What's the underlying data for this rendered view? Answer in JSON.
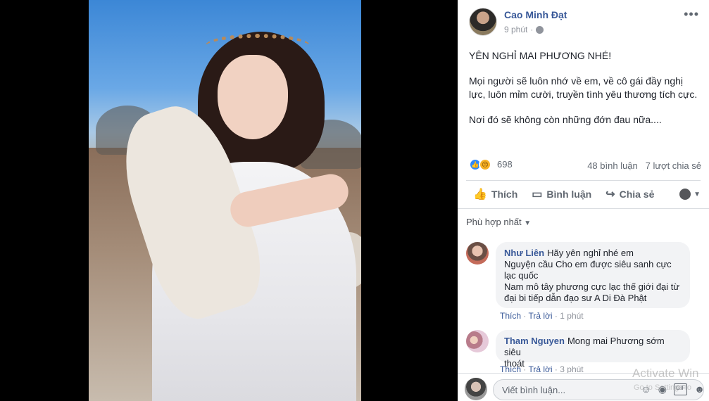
{
  "post": {
    "author": "Cao Minh Đạt",
    "time": "9 phút",
    "separator": "·",
    "more_icon": "ellipsis-icon",
    "paragraphs": [
      "YÊN NGHỈ MAI PHƯƠNG NHÉ!",
      "Mọi người sẽ luôn nhớ về em, về cô gái đầy nghị lực, luôn mỉm cười, truyền tình yêu thương tích cực.",
      "Nơi đó sẽ không còn những đớn đau nữa...."
    ],
    "reaction_count": "698",
    "comments_count": "48 bình luận",
    "shares_count": "7 lượt chia sẻ"
  },
  "actions": {
    "like": "Thích",
    "comment": "Bình luận",
    "share": "Chia sẻ"
  },
  "sort_label": "Phù hợp nhất",
  "comments": [
    {
      "name": "Như Liên",
      "first_line": "Hãy yên nghỉ nhé em",
      "lines": [
        "Nguyện cầu Cho em được siêu sanh cực",
        "lạc quốc",
        "Nam mô tây phương cực lạc thế giới đại từ",
        "đại bi tiếp dẫn đạo sư A Di Đà Phật"
      ],
      "like": "Thích",
      "reply": "Trả lời",
      "dot": "·",
      "time": "1 phút"
    },
    {
      "name": "Tham Nguyen",
      "first_line": "Mong mai Phương sớm siêu",
      "lines": [
        "thoát"
      ],
      "like": "Thích",
      "reply": "Trả lời",
      "dot": "·",
      "time": "3 phút"
    }
  ],
  "composer": {
    "placeholder": "Viết bình luận...",
    "gif": "GIF"
  },
  "overlay": {
    "activate": "Activate Win",
    "settings": "Go to Settings to"
  },
  "colors": {
    "link": "#385898",
    "like_blue": "#2d88ff",
    "sad_yellow": "#f7b125"
  }
}
